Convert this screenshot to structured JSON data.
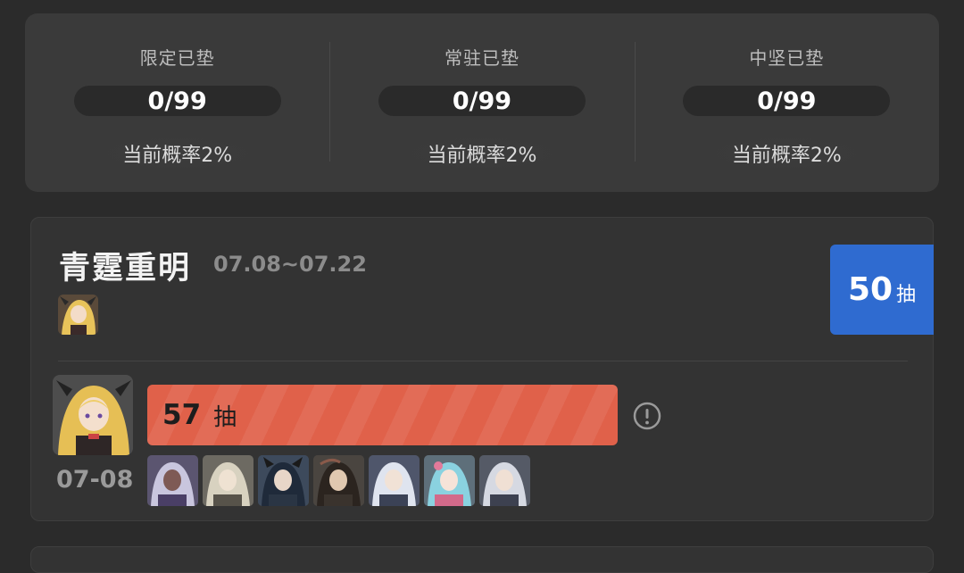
{
  "stats": [
    {
      "label": "限定已垫",
      "value": "0/99",
      "rate": "当前概率2%"
    },
    {
      "label": "常驻已垫",
      "value": "0/99",
      "rate": "当前概率2%"
    },
    {
      "label": "中坚已垫",
      "value": "0/99",
      "rate": "当前概率2%"
    }
  ],
  "banner": {
    "title": "青霆重明",
    "date_range": "07.08~07.22",
    "badge": {
      "count": "50",
      "unit": "抽"
    },
    "record": {
      "date": "07-08",
      "pull_count": "57",
      "pull_unit": "抽",
      "info_icon": "info-circle-icon"
    }
  },
  "colors": {
    "accent_blue": "#2f6bd0",
    "bar_red": "#e0614a"
  }
}
